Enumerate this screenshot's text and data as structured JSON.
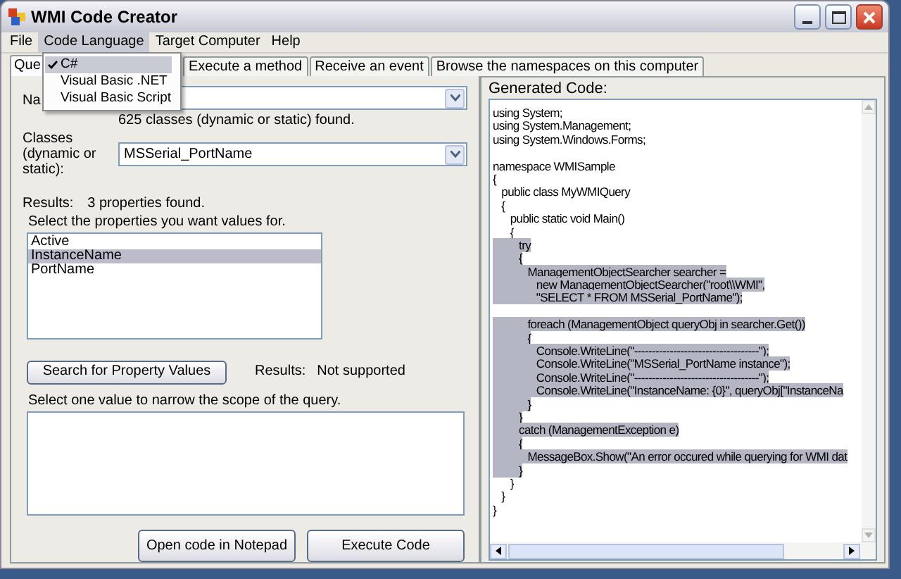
{
  "window": {
    "title": "WMI Code Creator"
  },
  "menu_bar": [
    {
      "label": "File",
      "selected": false
    },
    {
      "label": "Code Language",
      "selected": true
    },
    {
      "label": "Target Computer",
      "selected": false
    },
    {
      "label": "Help",
      "selected": false
    }
  ],
  "dropdown_menu": [
    {
      "label": "C#",
      "checked": true,
      "selected": true
    },
    {
      "label": "Visual Basic .NET",
      "checked": false,
      "selected": false
    },
    {
      "label": "Visual Basic Script",
      "checked": false,
      "selected": false
    }
  ],
  "tabs": [
    {
      "label": "Que",
      "selected": true
    },
    {
      "label": "Execute a method",
      "selected": false
    },
    {
      "label": "Receive an event",
      "selected": false
    },
    {
      "label": "Browse the namespaces on this computer",
      "selected": false
    }
  ],
  "namespace_field": {
    "label": "Na"
  },
  "class_count": "625 classes (dynamic or static) found.",
  "classes_field": {
    "label": "Classes (dynamic or static):",
    "value": "MSSerial_PortName"
  },
  "properties_results": {
    "label": "Results:",
    "value": "3 properties found."
  },
  "properties_prompt": "Select the properties you want values for.",
  "properties": [
    {
      "label": "Active",
      "selected": false
    },
    {
      "label": "InstanceName",
      "selected": true
    },
    {
      "label": "PortName",
      "selected": false
    }
  ],
  "search_button": "Search for Property Values",
  "values_results": {
    "label": "Results:",
    "value": "Not supported"
  },
  "values_prompt": "Select one value to narrow the scope of the query.",
  "buttons": [
    "Open code in Notepad",
    "Execute Code"
  ],
  "code_panel": {
    "title": "Generated Code:",
    "lines": [
      {
        "kind": "code",
        "text": "using System;",
        "selected": false
      },
      {
        "kind": "code",
        "text": "using System.Management;",
        "selected": false
      },
      {
        "kind": "code",
        "text": "using System.Windows.Forms;",
        "selected": false
      },
      {
        "kind": "blank"
      },
      {
        "kind": "code",
        "text": "namespace WMISample",
        "selected": false
      },
      {
        "kind": "code",
        "text": "{",
        "selected": false
      },
      {
        "kind": "code",
        "text": "   public class MyWMIQuery",
        "selected": false
      },
      {
        "kind": "code",
        "text": "   {",
        "selected": false
      },
      {
        "kind": "code",
        "text": "      public static void Main()",
        "selected": false
      },
      {
        "kind": "code",
        "text": "      {",
        "selected": false
      },
      {
        "kind": "code",
        "text": "         try",
        "selected": true
      },
      {
        "kind": "code",
        "text": "         {",
        "selected": true
      },
      {
        "kind": "code",
        "text": "            ManagementObjectSearcher searcher =",
        "selected": true
      },
      {
        "kind": "code",
        "text": "               new ManagementObjectSearcher(\"root\\\\WMI\",",
        "selected": true
      },
      {
        "kind": "code",
        "text": "               \"SELECT * FROM MSSerial_PortName\");",
        "selected": true
      },
      {
        "kind": "blank"
      },
      {
        "kind": "code",
        "text": "            foreach (ManagementObject queryObj in searcher.Get())",
        "selected": true
      },
      {
        "kind": "code",
        "text": "            {",
        "selected": true
      },
      {
        "kind": "code",
        "text": "               Console.WriteLine(\"-----------------------------------\");",
        "selected": true
      },
      {
        "kind": "code",
        "text": "               Console.WriteLine(\"MSSerial_PortName instance\");",
        "selected": true
      },
      {
        "kind": "code",
        "text": "               Console.WriteLine(\"-----------------------------------\");",
        "selected": true
      },
      {
        "kind": "code",
        "text": "               Console.WriteLine(\"InstanceName: {0}\", queryObj[\"InstanceNa",
        "selected": true
      },
      {
        "kind": "code",
        "text": "            }",
        "selected": true
      },
      {
        "kind": "code",
        "text": "         }",
        "selected": true
      },
      {
        "kind": "code",
        "text": "         catch (ManagementException e)",
        "selected": true
      },
      {
        "kind": "code",
        "text": "         {",
        "selected": true
      },
      {
        "kind": "code",
        "text": "            MessageBox.Show(\"An error occured while querying for WMI dat",
        "selected": true
      },
      {
        "kind": "code",
        "text": "         }",
        "selected": true
      },
      {
        "kind": "code",
        "text": "      }",
        "selected": false
      },
      {
        "kind": "code",
        "text": "   }",
        "selected": false
      },
      {
        "kind": "code",
        "text": "}",
        "selected": false
      }
    ]
  }
}
